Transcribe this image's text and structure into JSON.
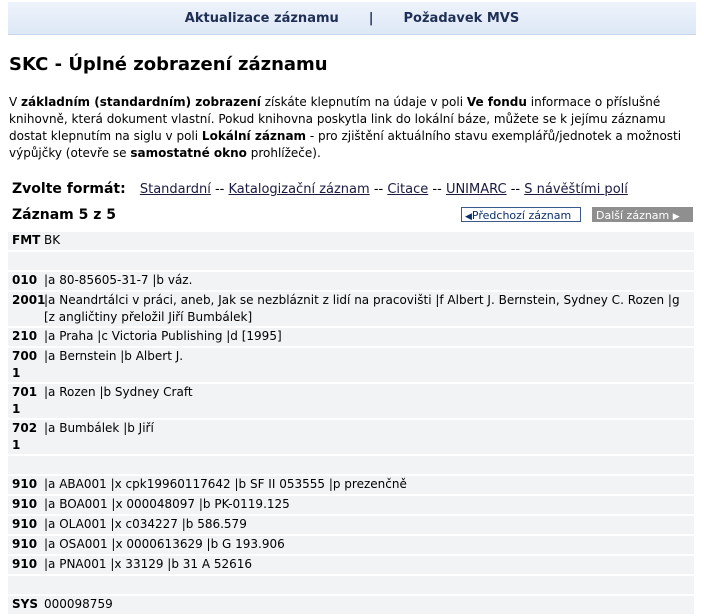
{
  "nav": {
    "update_label": "Aktualizace záznamu",
    "separator": "|",
    "mvs_label": "Požadavek MVS"
  },
  "page": {
    "title": "SKC - Úplné zobrazení záznamu"
  },
  "intro": {
    "p1": "V ",
    "b1": "základním (standardním) zobrazení",
    "p2": " získáte klepnutím na údaje v poli ",
    "b2": "Ve fondu",
    "p3": " informace o příslušné knihovně, která dokument vlastní. Pokud knihovna poskytla link do lokální báze, můžete se k jejímu záznamu dostat klepnutím na siglu v poli ",
    "b3": "Lokální záznam",
    "p4": " - pro zjištění aktuálního stavu exemplářů/jednotek a možnosti výpůjčky (otevře se ",
    "b4": "samostatné okno",
    "p5": " prohlížeče)."
  },
  "format": {
    "label": "Zvolte formát:",
    "options": [
      "Standardní",
      "Katalogizační záznam",
      "Citace",
      "UNIMARC",
      "S návěštími polí"
    ],
    "separator": "--"
  },
  "record_nav": {
    "count": "Záznam 5 z 5",
    "prev_label": "Předchozí záznam",
    "next_label": "Další záznam"
  },
  "records": [
    {
      "tag": "FMT",
      "value": "BK"
    },
    {
      "tag": "",
      "value": ""
    },
    {
      "tag": "010",
      "value": "|a 80-85605-31-7 |b váz."
    },
    {
      "tag": "2001",
      "value": "|a Neandrtálci v práci, aneb, Jak se nezbláznit z lidí na pracovišti |f Albert J. Bernstein, Sydney C. Rozen |g [z angličtiny přeložil Jiří Bumbálek]"
    },
    {
      "tag": "210",
      "value": "|a Praha |c Victoria Publishing |d [1995]"
    },
    {
      "tag": "700 1",
      "value": "|a Bernstein |b Albert J."
    },
    {
      "tag": "701 1",
      "value": "|a Rozen |b Sydney Craft"
    },
    {
      "tag": "702 1",
      "value": "|a Bumbálek |b Jiří"
    },
    {
      "tag": "",
      "value": ""
    },
    {
      "tag": "910",
      "value": "|a ABA001 |x cpk19960117642 |b SF II 053555 |p prezenčně"
    },
    {
      "tag": "910",
      "value": "|a BOA001 |x 000048097 |b PK-0119.125"
    },
    {
      "tag": "910",
      "value": "|a OLA001 |x c034227 |b 586.579"
    },
    {
      "tag": "910",
      "value": "|a OSA001 |x 0000613629 |b G 193.906"
    },
    {
      "tag": "910",
      "value": "|a PNA001 |x 33129 |b 31 A 52616"
    },
    {
      "tag": "",
      "value": ""
    },
    {
      "tag": "SYS",
      "value": "000098759"
    }
  ],
  "icons": {
    "prev": "triangle-left-icon",
    "next": "triangle-right-icon"
  }
}
